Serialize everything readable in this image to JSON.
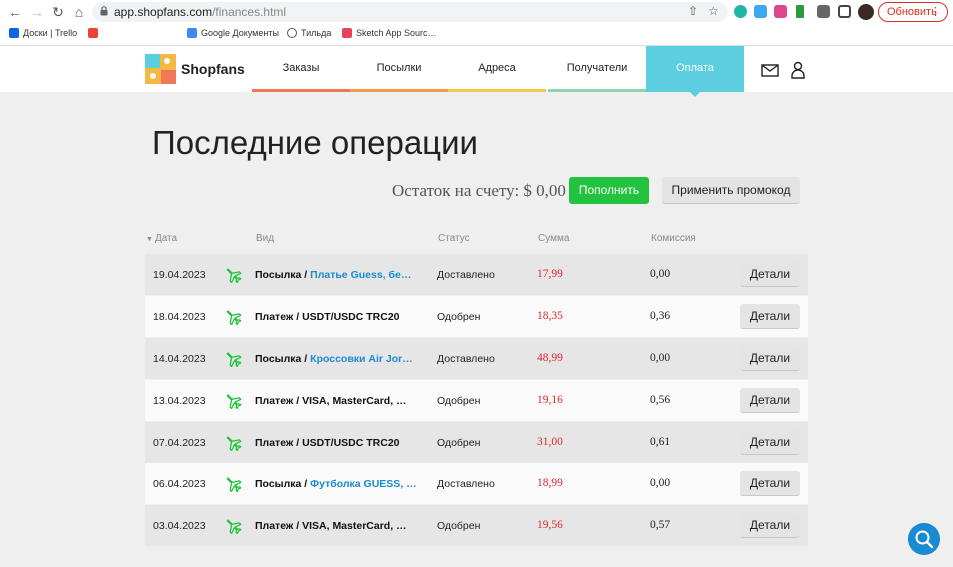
{
  "browser": {
    "url_host": "app.shopfans.com",
    "url_path": "/finances.html",
    "update_label": "Обновить",
    "bookmarks": [
      {
        "label": "Доски | Trello",
        "color": "#0c66e4"
      },
      {
        "label": "",
        "color": "#ea4335"
      },
      {
        "label": "Google Документы",
        "color": "#4285f4"
      },
      {
        "label": "Тильда",
        "color": "#555555"
      },
      {
        "label": "Sketch App Sourc…",
        "color": "#e6425e"
      }
    ]
  },
  "site": {
    "logo_text": "Shopfans",
    "nav": [
      {
        "label": "Заказы",
        "color": "#f0785a"
      },
      {
        "label": "Посылки",
        "color": "#f39d4a"
      },
      {
        "label": "Адреса",
        "color": "#f5c84c"
      },
      {
        "label": "Получатели",
        "color": "#8fd4b0"
      },
      {
        "label": "Оплата",
        "color": "#5bcfe0"
      }
    ]
  },
  "main": {
    "title": "Последние операции",
    "balance": "Остаток на счету: $ 0,00",
    "topup_label": "Пополнить",
    "promo_label": "Применить промокод",
    "columns": {
      "date": "Дата",
      "kind": "Вид",
      "status": "Статус",
      "sum": "Сумма",
      "fee": "Комиссия"
    },
    "details_label": "Детали",
    "rows": [
      {
        "date": "19.04.2023",
        "kind": "Посылка / ",
        "link": "Платье Guess, бе…",
        "status": "Доставлено",
        "sum": "17,99",
        "fee": "0,00"
      },
      {
        "date": "18.04.2023",
        "kind": "Платеж / USDT/USDC TRC20",
        "link": "",
        "status": "Одобрен",
        "sum": "18,35",
        "fee": "0,36"
      },
      {
        "date": "14.04.2023",
        "kind": "Посылка / ",
        "link": "Кроссовки Air Jor…",
        "status": "Доставлено",
        "sum": "48,99",
        "fee": "0,00"
      },
      {
        "date": "13.04.2023",
        "kind": "Платеж / VISA, MasterCard, …",
        "link": "",
        "status": "Одобрен",
        "sum": "19,16",
        "fee": "0,56"
      },
      {
        "date": "07.04.2023",
        "kind": "Платеж / USDT/USDC TRC20",
        "link": "",
        "status": "Одобрен",
        "sum": "31,00",
        "fee": "0,61"
      },
      {
        "date": "06.04.2023",
        "kind": "Посылка / ",
        "link": "Футболка GUESS, …",
        "status": "Доставлено",
        "sum": "18,99",
        "fee": "0,00"
      },
      {
        "date": "03.04.2023",
        "kind": "Платеж / VISA, MasterCard, …",
        "link": "",
        "status": "Одобрен",
        "sum": "19,56",
        "fee": "0,57"
      }
    ]
  }
}
